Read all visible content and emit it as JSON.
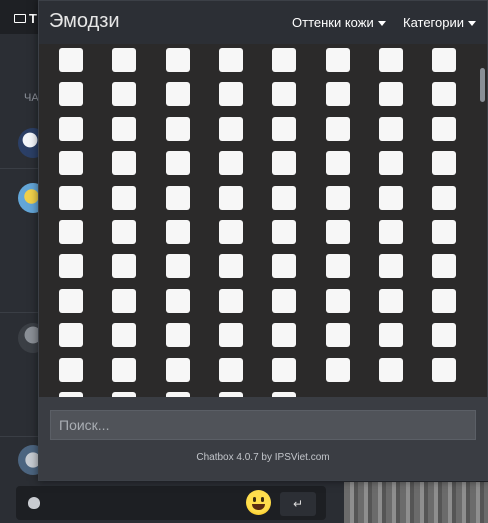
{
  "background": {
    "tab_label": "Т",
    "section_label": "ЧА",
    "send_icon": "↵"
  },
  "popup": {
    "title": "Эмодзи",
    "skin_tones_label": "Оттенки кожи",
    "categories_label": "Категории",
    "search_placeholder": "Поиск...",
    "credit": "Chatbox 4.0.7 by IPSViet.com"
  },
  "emoji_grid": {
    "columns": 8,
    "full_rows": 10,
    "partial_row_cells": 5
  },
  "colors": {
    "popup_bg": "#2c2f35",
    "footer_bg": "#3a3d43",
    "emoji_placeholder": "#f7f7f7"
  }
}
